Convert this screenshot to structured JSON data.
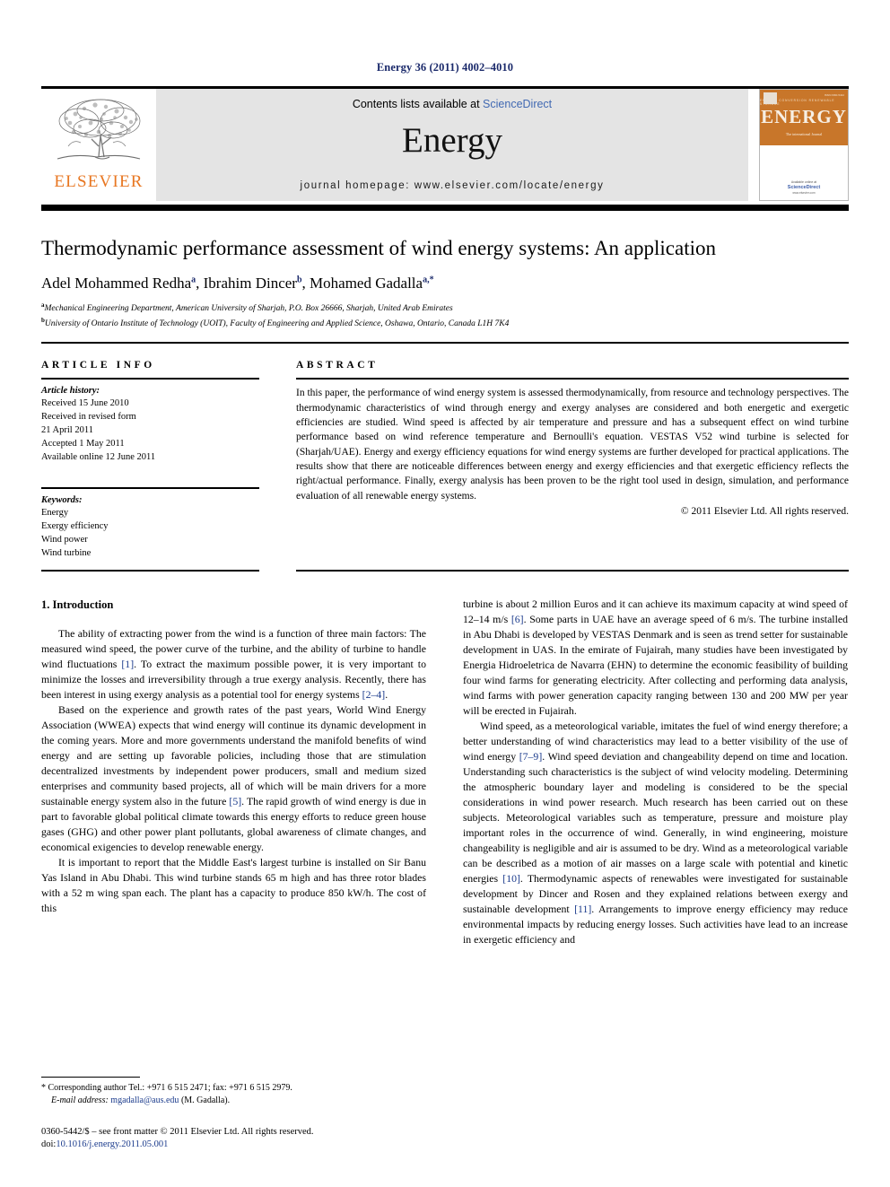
{
  "running_head": "Energy 36 (2011) 4002–4010",
  "masthead": {
    "publisher_logo_text": "ELSEVIER",
    "contents_prefix": "Contents lists available at ",
    "contents_link": "ScienceDirect",
    "journal_name": "Energy",
    "homepage_line": "journal homepage: www.elsevier.com/locate/energy",
    "cover": {
      "title": "ENERGY",
      "subtitle": "The international Journal",
      "top_tiny": "ENERGY CONVERSION RENEWABLE STORAGE",
      "issue_tag": "ISSN 0360-5442",
      "sd_label": "Available online at",
      "sd_logo": "ScienceDirect",
      "url": "www.elsevier.com"
    }
  },
  "article": {
    "title": "Thermodynamic performance assessment of wind energy systems: An application",
    "authors": [
      {
        "name": "Adel Mohammed Redha",
        "marks": "a"
      },
      {
        "name": "Ibrahim Dincer",
        "marks": "b"
      },
      {
        "name": "Mohamed Gadalla",
        "marks": "a,*"
      }
    ],
    "affiliations": [
      {
        "mark": "a",
        "text": "Mechanical Engineering Department, American University of Sharjah, P.O. Box 26666, Sharjah, United Arab Emirates"
      },
      {
        "mark": "b",
        "text": "University of Ontario Institute of Technology (UOIT), Faculty of Engineering and Applied Science, Oshawa, Ontario, Canada L1H 7K4"
      }
    ]
  },
  "article_info": {
    "label": "ARTICLE INFO",
    "history_heading": "Article history:",
    "history": [
      "Received 15 June 2010",
      "Received in revised form",
      "21 April 2011",
      "Accepted 1 May 2011",
      "Available online 12 June 2011"
    ],
    "keywords_heading": "Keywords:",
    "keywords": [
      "Energy",
      "Exergy efficiency",
      "Wind power",
      "Wind turbine"
    ]
  },
  "abstract": {
    "label": "ABSTRACT",
    "text": "In this paper, the performance of wind energy system is assessed thermodynamically, from resource and technology perspectives. The thermodynamic characteristics of wind through energy and exergy analyses are considered and both energetic and exergetic efficiencies are studied. Wind speed is affected by air temperature and pressure and has a subsequent effect on wind turbine performance based on wind reference temperature and Bernoulli's equation. VESTAS V52 wind turbine is selected for (Sharjah/UAE). Energy and exergy efficiency equations for wind energy systems are further developed for practical applications. The results show that there are noticeable differences between energy and exergy efficiencies and that exergetic efficiency reflects the right/actual performance. Finally, exergy analysis has been proven to be the right tool used in design, simulation, and performance evaluation of all renewable energy systems.",
    "copyright": "© 2011 Elsevier Ltd. All rights reserved."
  },
  "body": {
    "section_title": "1. Introduction",
    "left_paragraphs": [
      "The ability of extracting power from the wind is a function of three main factors: The measured wind speed, the power curve of the turbine, and the ability of turbine to handle wind fluctuations [1]. To extract the maximum possible power, it is very important to minimize the losses and irreversibility through a true exergy analysis. Recently, there has been interest in using exergy analysis as a potential tool for energy systems [2–4].",
      "Based on the experience and growth rates of the past years, World Wind Energy Association (WWEA) expects that wind energy will continue its dynamic development in the coming years. More and more governments understand the manifold benefits of wind energy and are setting up favorable policies, including those that are stimulation decentralized investments by independent power producers, small and medium sized enterprises and community based projects, all of which will be main drivers for a more sustainable energy system also in the future [5]. The rapid growth of wind energy is due in part to favorable global political climate towards this energy efforts to reduce green house gases (GHG) and other power plant pollutants, global awareness of climate changes, and economical exigencies to develop renewable energy.",
      "It is important to report that the Middle East's largest turbine is installed on Sir Banu Yas Island in Abu Dhabi. This wind turbine stands 65 m high and has three rotor blades with a 52 m wing span each. The plant has a capacity to produce 850 kW/h. The cost of this"
    ],
    "right_paragraphs": [
      "turbine is about 2 million Euros and it can achieve its maximum capacity at wind speed of 12–14 m/s [6]. Some parts in UAE have an average speed of 6 m/s. The turbine installed in Abu Dhabi is developed by VESTAS Denmark and is seen as trend setter for sustainable development in UAS. In the emirate of Fujairah, many studies have been investigated by Energia Hidroeletrica de Navarra (EHN) to determine the economic feasibility of building four wind farms for generating electricity. After collecting and performing data analysis, wind farms with power generation capacity ranging between 130 and 200 MW per year will be erected in Fujairah.",
      "Wind speed, as a meteorological variable, imitates the fuel of wind energy therefore; a better understanding of wind characteristics may lead to a better visibility of the use of wind energy [7–9]. Wind speed deviation and changeability depend on time and location. Understanding such characteristics is the subject of wind velocity modeling. Determining the atmospheric boundary layer and modeling is considered to be the special considerations in wind power research. Much research has been carried out on these subjects. Meteorological variables such as temperature, pressure and moisture play important roles in the occurrence of wind. Generally, in wind engineering, moisture changeability is negligible and air is assumed to be dry. Wind as a meteorological variable can be described as a motion of air masses on a large scale with potential and kinetic energies [10]. Thermodynamic aspects of renewables were investigated for sustainable development by Dincer and Rosen and they explained relations between exergy and sustainable development [11]. Arrangements to improve energy efficiency may reduce environmental impacts by reducing energy losses. Such activities have lead to an increase in exergetic efficiency and"
    ]
  },
  "footnotes": {
    "corresponding": "* Corresponding author Tel.: +971 6 515 2471; fax: +971 6 515 2979.",
    "email_label": "E-mail address:",
    "email": "mgadalla@aus.edu",
    "email_suffix": "(M. Gadalla).",
    "issn_line": "0360-5442/$ – see front matter © 2011 Elsevier Ltd. All rights reserved.",
    "doi_label": "doi:",
    "doi": "10.1016/j.energy.2011.05.001"
  },
  "colors": {
    "link_blue": "#1b3b8c",
    "sciencedirect_blue": "#4169b2",
    "elsevier_orange": "#e87722",
    "cover_orange": "#c8762a",
    "masthead_gray": "#e4e4e4"
  }
}
